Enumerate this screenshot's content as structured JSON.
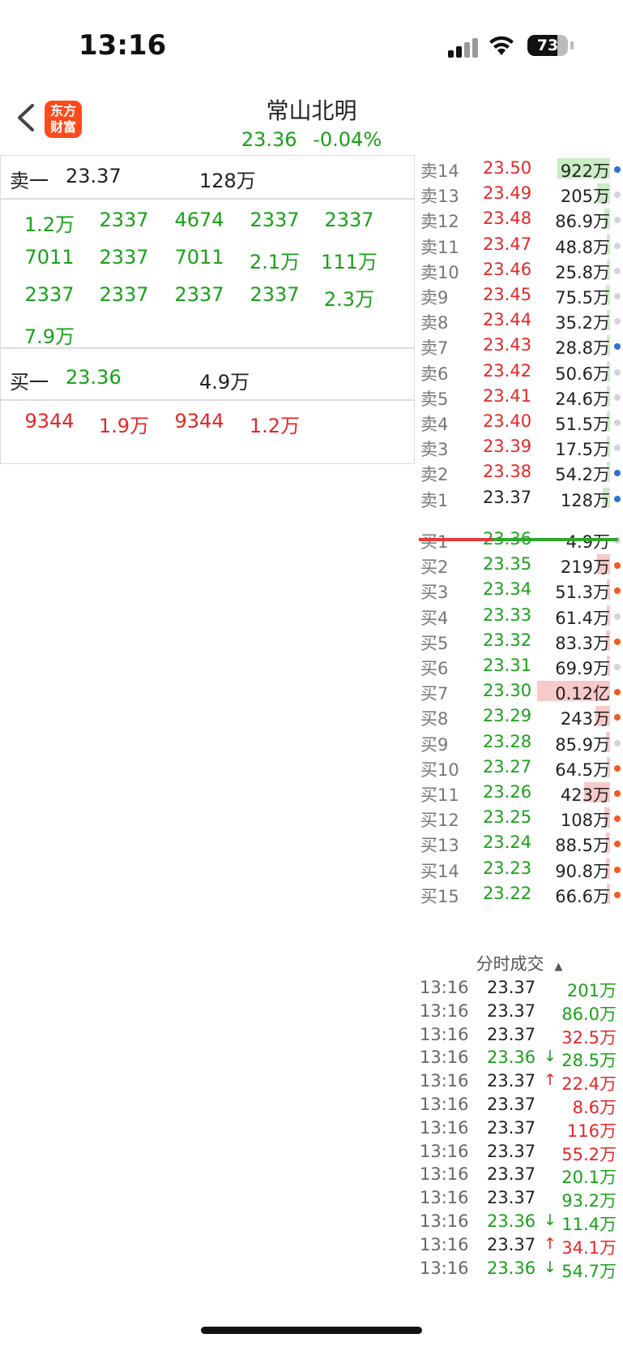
{
  "status_bar": {
    "time": "13:16",
    "battery": "73"
  },
  "header": {
    "title": "常山北明",
    "price": "23.36",
    "change": "-0.04%",
    "logo_line1": "东方",
    "logo_line2": "财富"
  },
  "colors": {
    "red": "#e62626",
    "green": "#1aa01a",
    "dark": "#222222",
    "grey_dot": "#d4d4d8",
    "blue_dot": "#2f6fd6",
    "orange_dot": "#f25a1e"
  },
  "left_panel": {
    "sell_one": {
      "label": "卖一",
      "price": "23.37",
      "volume": "128万"
    },
    "sell_queue": [
      "1.2万",
      "2337",
      "4674",
      "2337",
      "2337",
      "7011",
      "2337",
      "7011",
      "2.1万",
      "111万",
      "2337",
      "2337",
      "2337",
      "2337",
      "2.3万",
      "7.9万"
    ],
    "buy_one": {
      "label": "买一",
      "price": "23.36",
      "volume": "4.9万"
    },
    "buy_queue": [
      "9344",
      "1.9万",
      "9344",
      "1.2万"
    ]
  },
  "order_book": {
    "asks": [
      {
        "label": "卖14",
        "price": "23.50",
        "volume": "922万",
        "bar": 0.36,
        "dot": "blue"
      },
      {
        "label": "卖13",
        "price": "23.49",
        "volume": "205万",
        "bar": 0.09,
        "dot": "grey"
      },
      {
        "label": "卖12",
        "price": "23.48",
        "volume": "86.9万",
        "bar": 0.04,
        "dot": "grey"
      },
      {
        "label": "卖11",
        "price": "23.47",
        "volume": "48.8万",
        "bar": 0.02,
        "dot": "grey"
      },
      {
        "label": "卖10",
        "price": "23.46",
        "volume": "25.8万",
        "bar": 0.02,
        "dot": "grey"
      },
      {
        "label": "卖9",
        "price": "23.45",
        "volume": "75.5万",
        "bar": 0.03,
        "dot": "grey"
      },
      {
        "label": "卖8",
        "price": "23.44",
        "volume": "35.2万",
        "bar": 0.02,
        "dot": "grey"
      },
      {
        "label": "卖7",
        "price": "23.43",
        "volume": "28.8万",
        "bar": 0.02,
        "dot": "blue"
      },
      {
        "label": "卖6",
        "price": "23.42",
        "volume": "50.6万",
        "bar": 0.02,
        "dot": "grey"
      },
      {
        "label": "卖5",
        "price": "23.41",
        "volume": "24.6万",
        "bar": 0.02,
        "dot": "grey"
      },
      {
        "label": "卖4",
        "price": "23.40",
        "volume": "51.5万",
        "bar": 0.02,
        "dot": "grey"
      },
      {
        "label": "卖3",
        "price": "23.39",
        "volume": "17.5万",
        "bar": 0.02,
        "dot": "grey"
      },
      {
        "label": "卖2",
        "price": "23.38",
        "volume": "54.2万",
        "bar": 0.02,
        "dot": "blue"
      },
      {
        "label": "卖1",
        "price": "23.37",
        "volume": "128万",
        "bar": 0.05,
        "dot": "blue"
      }
    ],
    "bids": [
      {
        "label": "买1",
        "price": "23.36",
        "volume": "4.9万",
        "bar": 0.0,
        "dot": "grey"
      },
      {
        "label": "买2",
        "price": "23.35",
        "volume": "219万",
        "bar": 0.09,
        "dot": "orange"
      },
      {
        "label": "买3",
        "price": "23.34",
        "volume": "51.3万",
        "bar": 0.02,
        "dot": "orange"
      },
      {
        "label": "买4",
        "price": "23.33",
        "volume": "61.4万",
        "bar": 0.02,
        "dot": "grey"
      },
      {
        "label": "买5",
        "price": "23.32",
        "volume": "83.3万",
        "bar": 0.03,
        "dot": "orange"
      },
      {
        "label": "买6",
        "price": "23.31",
        "volume": "69.9万",
        "bar": 0.02,
        "dot": "grey"
      },
      {
        "label": "买7",
        "price": "23.30",
        "volume": "0.12亿",
        "bar": 0.5,
        "dot": "orange"
      },
      {
        "label": "买8",
        "price": "23.29",
        "volume": "243万",
        "bar": 0.1,
        "dot": "orange"
      },
      {
        "label": "买9",
        "price": "23.28",
        "volume": "85.9万",
        "bar": 0.03,
        "dot": "grey"
      },
      {
        "label": "买10",
        "price": "23.27",
        "volume": "64.5万",
        "bar": 0.02,
        "dot": "orange"
      },
      {
        "label": "买11",
        "price": "23.26",
        "volume": "423万",
        "bar": 0.18,
        "dot": "orange"
      },
      {
        "label": "买12",
        "price": "23.25",
        "volume": "108万",
        "bar": 0.04,
        "dot": "orange"
      },
      {
        "label": "买13",
        "price": "23.24",
        "volume": "88.5万",
        "bar": 0.03,
        "dot": "orange"
      },
      {
        "label": "买14",
        "price": "23.23",
        "volume": "90.8万",
        "bar": 0.03,
        "dot": "orange"
      },
      {
        "label": "买15",
        "price": "23.22",
        "volume": "66.6万",
        "bar": 0.02,
        "dot": "orange"
      }
    ],
    "divider_red_ratio": 0.37
  },
  "ticks": {
    "title": "分时成交",
    "rows": [
      {
        "time": "13:16",
        "price": "23.37",
        "arrow": "",
        "volume": "201万",
        "color": "green"
      },
      {
        "time": "13:16",
        "price": "23.37",
        "arrow": "",
        "volume": "86.0万",
        "color": "green"
      },
      {
        "time": "13:16",
        "price": "23.37",
        "arrow": "",
        "volume": "32.5万",
        "color": "red"
      },
      {
        "time": "13:16",
        "price": "23.36",
        "arrow": "↓",
        "volume": "28.5万",
        "color": "green"
      },
      {
        "time": "13:16",
        "price": "23.37",
        "arrow": "↑",
        "volume": "22.4万",
        "color": "red"
      },
      {
        "time": "13:16",
        "price": "23.37",
        "arrow": "",
        "volume": "8.6万",
        "color": "red"
      },
      {
        "time": "13:16",
        "price": "23.37",
        "arrow": "",
        "volume": "116万",
        "color": "red"
      },
      {
        "time": "13:16",
        "price": "23.37",
        "arrow": "",
        "volume": "55.2万",
        "color": "red"
      },
      {
        "time": "13:16",
        "price": "23.37",
        "arrow": "",
        "volume": "20.1万",
        "color": "green"
      },
      {
        "time": "13:16",
        "price": "23.37",
        "arrow": "",
        "volume": "93.2万",
        "color": "green"
      },
      {
        "time": "13:16",
        "price": "23.36",
        "arrow": "↓",
        "volume": "11.4万",
        "color": "green"
      },
      {
        "time": "13:16",
        "price": "23.37",
        "arrow": "↑",
        "volume": "34.1万",
        "color": "red"
      },
      {
        "time": "13:16",
        "price": "23.36",
        "arrow": "↓",
        "volume": "54.7万",
        "color": "green"
      }
    ]
  }
}
